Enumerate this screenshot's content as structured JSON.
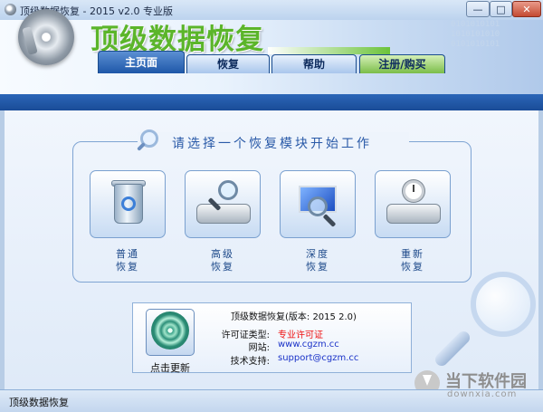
{
  "window": {
    "title": "顶级数据恢复 - 2015 v2.0 专业版",
    "minimize_label": "—",
    "maximize_label": "□",
    "close_label": "✕"
  },
  "header": {
    "app_title": "顶级数据恢复",
    "binary_text": "0101010101 1010101010 0101010101"
  },
  "tabs": [
    {
      "label": "主页面",
      "active": true
    },
    {
      "label": "恢复",
      "active": false
    },
    {
      "label": "帮助",
      "active": false
    },
    {
      "label": "注册/购买",
      "active": false
    }
  ],
  "main": {
    "heading": "请选择一个恢复模块开始工作",
    "modules": [
      {
        "line1": "普通",
        "line2": "恢复",
        "icon": "recycle-bin-icon"
      },
      {
        "line1": "高级",
        "line2": "恢复",
        "icon": "hard-drive-magnifier-icon"
      },
      {
        "line1": "深度",
        "line2": "恢复",
        "icon": "monitor-magnifier-icon"
      },
      {
        "line1": "重新",
        "line2": "恢复",
        "icon": "hard-drive-clock-icon"
      }
    ]
  },
  "info": {
    "update_label": "点击更新",
    "title": "顶级数据恢复(版本: 2015 2.0)",
    "license_label": "许可证类型:",
    "license_value": "专业许可证",
    "website_label": "网站:",
    "website_value": "www.cgzm.cc",
    "support_label": "技术支持:",
    "support_value": "support@cgzm.cc"
  },
  "watermark": {
    "text": "当下软件园",
    "url": "downxia.com"
  },
  "status": {
    "text": "顶级数据恢复"
  },
  "colors": {
    "accent_blue": "#1e57a8",
    "title_green": "#5bb52a",
    "license_red": "#e11111",
    "link_blue": "#1a32c8"
  }
}
